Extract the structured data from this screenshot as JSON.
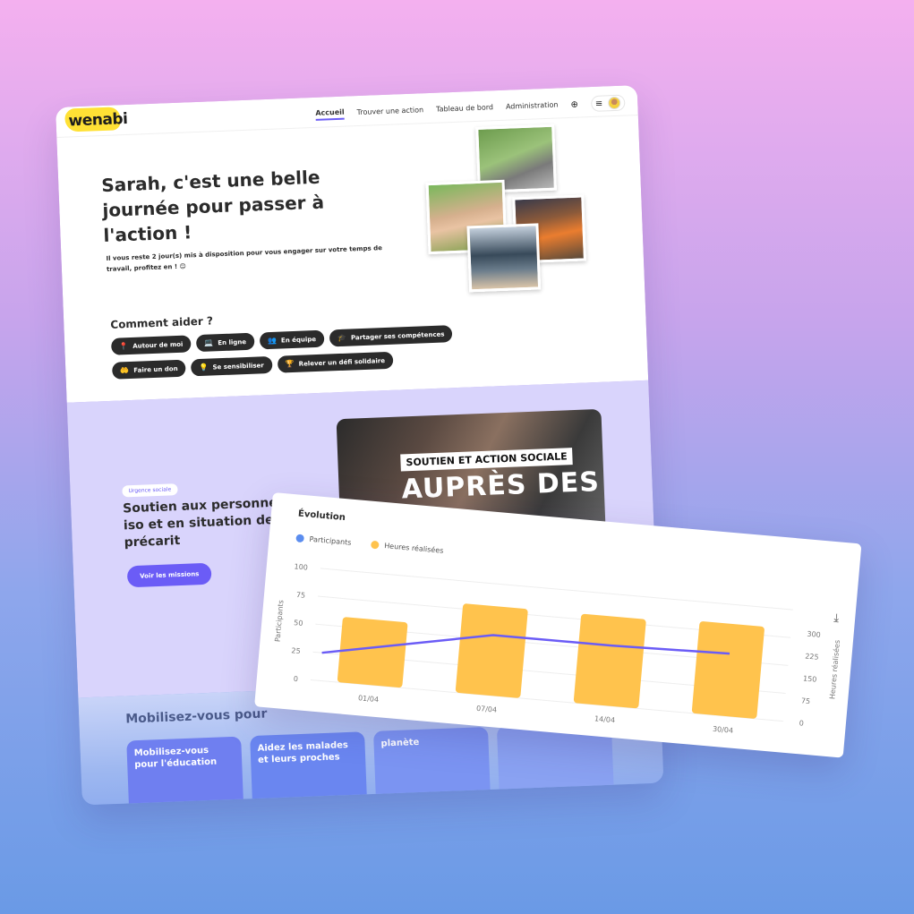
{
  "nav": {
    "logo": "wenabi",
    "links": [
      "Accueil",
      "Trouver une action",
      "Tableau de bord",
      "Administration"
    ],
    "globe_icon": "globe-icon",
    "menu_icon": "hamburger-icon"
  },
  "hero": {
    "title": "Sarah, c'est une belle journée pour passer à l'action !",
    "subtitle": "Il vous reste 2 jour(s) mis à disposition pour vous engager sur votre temps de travail, profitez en ! 😊"
  },
  "help": {
    "title": "Comment aider ?",
    "chips": [
      {
        "label": "Autour de moi",
        "icon": "📍"
      },
      {
        "label": "En ligne",
        "icon": "💻"
      },
      {
        "label": "En équipe",
        "icon": "👥"
      },
      {
        "label": "Partager ses compétences",
        "icon": "🎓"
      },
      {
        "label": "Faire un don",
        "icon": "🤲"
      },
      {
        "label": "Se sensibiliser",
        "icon": "💡"
      },
      {
        "label": "Relever un défi solidaire",
        "icon": "🏆"
      }
    ]
  },
  "cause": {
    "badge": "Urgence sociale",
    "title": "Soutien aux personnes iso et en situation de précarit",
    "button": "Voir les missions",
    "video_caption": "SOUTIEN ET ACTION SOCIALE",
    "video_big": "AUPRÈS DES"
  },
  "mobilize": {
    "title": "Mobilisez-vous pour",
    "cards": [
      "Mobilisez-vous pour l'éducation",
      "Aidez les malades et leurs proches",
      "planète",
      ""
    ]
  },
  "chart": {
    "title": "Évolution",
    "download_icon": "download-icon",
    "colors": {
      "participants": "#6b5cf6",
      "hours": "#ffc34d",
      "participants_dot": "#5b8def"
    }
  },
  "chart_data": {
    "type": "bar",
    "title": "Évolution",
    "categories": [
      "01/04",
      "07/04",
      "14/04",
      "30/04"
    ],
    "series": [
      {
        "name": "Heures réalisées",
        "type": "bar",
        "axis": "right",
        "values": [
          220,
          300,
          300,
          310
        ]
      },
      {
        "name": "Participants",
        "type": "line",
        "axis": "left",
        "values": [
          25,
          54,
          54,
          56
        ]
      }
    ],
    "ylabel_left": "Participants",
    "ylabel_right": "Heures réalisées",
    "ylim_left": [
      0,
      100
    ],
    "ylim_right": [
      0,
      375
    ],
    "yticks_left": [
      0,
      25,
      50,
      75,
      100
    ],
    "yticks_right": [
      0,
      75,
      150,
      225,
      300
    ],
    "legend": "top-left",
    "grid": true
  }
}
